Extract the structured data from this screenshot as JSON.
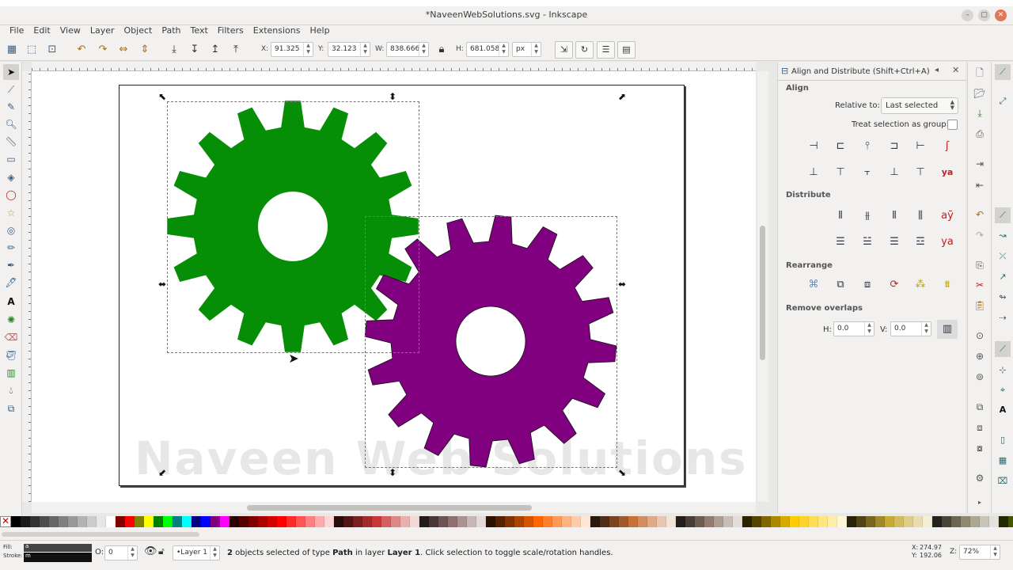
{
  "window": {
    "title": "*NaveenWebSolutions.svg - Inkscape"
  },
  "menu": [
    "File",
    "Edit",
    "View",
    "Layer",
    "Object",
    "Path",
    "Text",
    "Filters",
    "Extensions",
    "Help"
  ],
  "controls": {
    "x_label": "X:",
    "x_value": "91.325",
    "y_label": "Y:",
    "y_value": "32.123",
    "w_label": "W:",
    "w_value": "838.666",
    "h_label": "H:",
    "h_value": "681.058",
    "unit": "px"
  },
  "canvas": {
    "watermark": "Naveen Web Solutions",
    "gear1_color": "#068f06",
    "gear2_color": "#800080",
    "gear_outline": "#111111"
  },
  "align_panel": {
    "title": "Align and Distribute (Shift+Ctrl+A)",
    "align_heading": "Align",
    "relative_label": "Relative to:",
    "relative_value": "Last selected",
    "treat_group_label": "Treat selection as group:",
    "distribute_heading": "Distribute",
    "rearrange_heading": "Rearrange",
    "remove_overlaps_heading": "Remove overlaps",
    "h_label": "H:",
    "h_value": "0.0",
    "v_label": "V:",
    "v_value": "0.0"
  },
  "palette_colors": [
    "#000000",
    "#1a1a1a",
    "#333333",
    "#4d4d4d",
    "#666666",
    "#808080",
    "#999999",
    "#b3b3b3",
    "#cccccc",
    "#e6e6e6",
    "#ffffff",
    "#800000",
    "#ff0000",
    "#808000",
    "#ffff00",
    "#008000",
    "#00ff00",
    "#008080",
    "#00ffff",
    "#000080",
    "#0000ff",
    "#800080",
    "#ff00ff",
    "#2b0000",
    "#550000",
    "#800000",
    "#aa0000",
    "#d40000",
    "#ff0000",
    "#ff2a2a",
    "#ff5555",
    "#ff8080",
    "#ffaaaa",
    "#ffd5d5",
    "#280b0b",
    "#501616",
    "#782121",
    "#a02c2c",
    "#c83737",
    "#d35f5f",
    "#de8787",
    "#e9afaf",
    "#f4d7d7",
    "#241c1c",
    "#483737",
    "#6c5353",
    "#916f6f",
    "#ac9393",
    "#c8b7b7",
    "#e3dbdb",
    "#2b1100",
    "#552200",
    "#803300",
    "#aa4400",
    "#d45500",
    "#ff6600",
    "#ff7f2a",
    "#ff9955",
    "#ffb380",
    "#ffccaa",
    "#ffe6d5",
    "#28170b",
    "#502d16",
    "#784421",
    "#a05a2c",
    "#c87137",
    "#d38d5f",
    "#deaa87",
    "#e9c6af",
    "#f4e3d7",
    "#241f1c",
    "#483e37",
    "#6c5d53",
    "#917c6f",
    "#ac9d93",
    "#c8beb7",
    "#e3dedb",
    "#2b2200",
    "#554400",
    "#806600",
    "#aa8800",
    "#d4aa00",
    "#ffcc00",
    "#ffd42a",
    "#ffdd55",
    "#ffe680",
    "#ffeeaa",
    "#fff6d5",
    "#28220b",
    "#504416",
    "#786721",
    "#a0892c",
    "#c8ab37",
    "#d3bc5f",
    "#decd87",
    "#e9ddaf",
    "#f4eed7",
    "#24221c",
    "#484537",
    "#6c6753",
    "#91896f",
    "#aca793",
    "#c8c4b7",
    "#e3e2db",
    "#222b00",
    "#445500",
    "#668000",
    "#88aa00",
    "#aad400",
    "#ccff00"
  ],
  "status": {
    "fill_label": "Fill:",
    "fill_value": "a",
    "stroke_label": "Stroke:",
    "stroke_value": "m",
    "opacity_label": "O:",
    "opacity_value": "0",
    "layer": "•Layer 1",
    "message_count": "2",
    "message_pre": " objects selected of type ",
    "message_type": "Path",
    "message_mid": " in layer ",
    "message_layer": "Layer 1",
    "message_post": ". Click selection to toggle scale/rotation handles.",
    "cursor_x_label": "X:",
    "cursor_x": "274.97",
    "cursor_y_label": "Y:",
    "cursor_y": "192.06",
    "zoom_label": "Z:",
    "zoom": "72%"
  }
}
